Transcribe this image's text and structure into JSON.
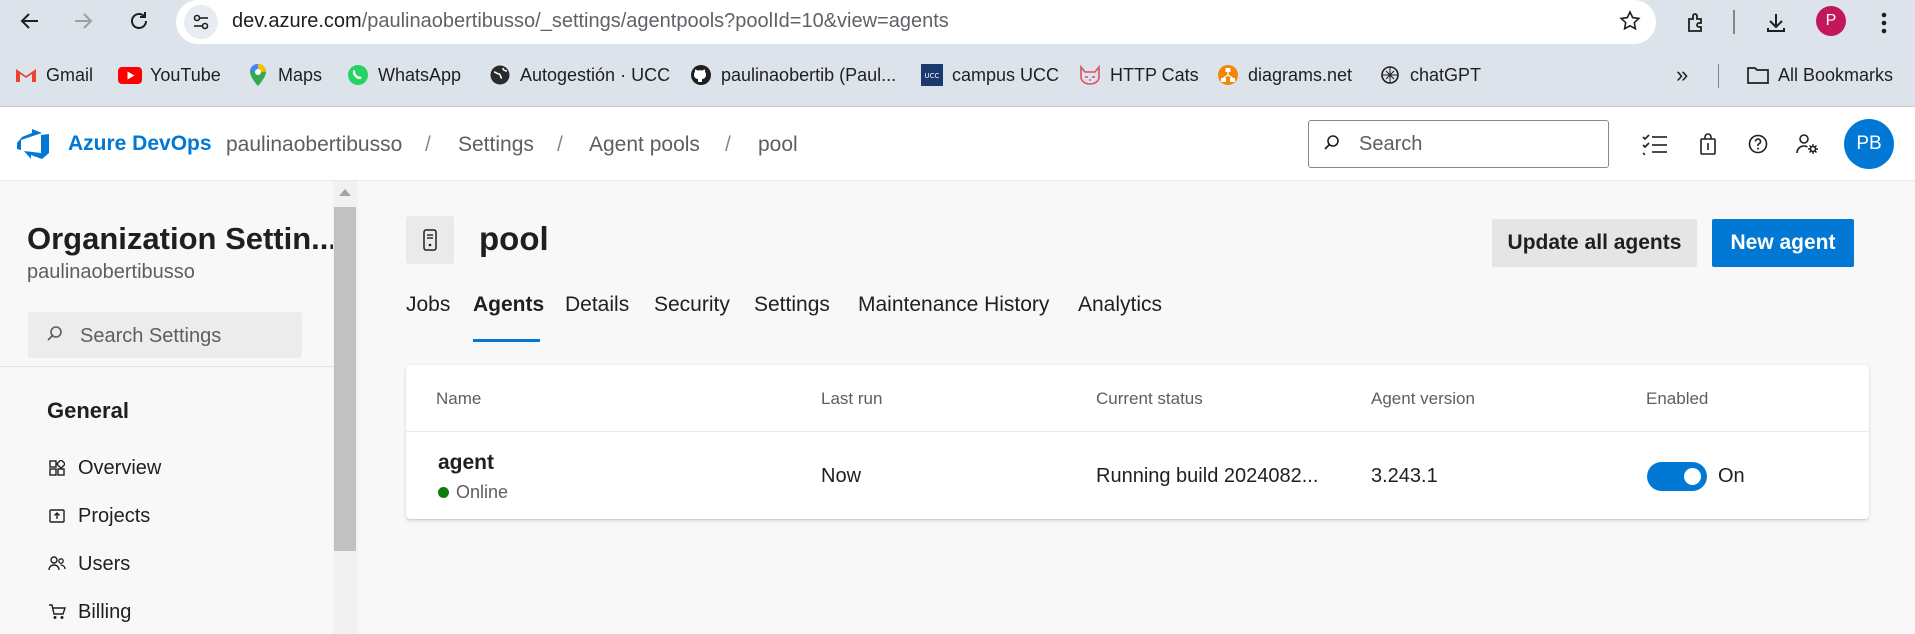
{
  "browser": {
    "url_host": "dev.azure.com",
    "url_path": "/paulinaobertibusso/_settings/agentpools?poolId=10&view=agents",
    "profile_initial": "P",
    "bookmarks": [
      {
        "label": "Gmail",
        "icon": "gmail-icon",
        "color": "#ea4335"
      },
      {
        "label": "YouTube",
        "icon": "youtube-icon",
        "color": "#ff0000"
      },
      {
        "label": "Maps",
        "icon": "maps-icon",
        "color": "#34a853"
      },
      {
        "label": "WhatsApp",
        "icon": "whatsapp-icon",
        "color": "#25d366"
      },
      {
        "label": "Autogestión · UCC",
        "icon": "globe-icon",
        "color": "#1f1f1f"
      },
      {
        "label": "paulinaobertib (Paul...",
        "icon": "github-icon",
        "color": "#1f1f1f"
      },
      {
        "label": "campus UCC",
        "icon": "ucc-icon",
        "color": "#1a3a6e"
      },
      {
        "label": "HTTP Cats",
        "icon": "cat-icon",
        "color": "#d8535f"
      },
      {
        "label": "diagrams.net",
        "icon": "diagrams-icon",
        "color": "#f08705"
      },
      {
        "label": "chatGPT",
        "icon": "openai-icon",
        "color": "#1f1f1f"
      }
    ],
    "more_label": "»",
    "all_bookmarks_label": "All Bookmarks"
  },
  "header": {
    "brand": "Azure DevOps",
    "breadcrumbs": [
      "paulinaobertibusso",
      "Settings",
      "Agent pools",
      "pool"
    ],
    "search_placeholder": "Search",
    "avatar_initials": "PB",
    "accent": "#0078d4"
  },
  "sidebar": {
    "title": "Organization Settin...",
    "subtitle": "paulinaobertibusso",
    "search_placeholder": "Search Settings",
    "group_title": "General",
    "items": [
      {
        "label": "Overview",
        "icon": "overview-icon"
      },
      {
        "label": "Projects",
        "icon": "projects-icon"
      },
      {
        "label": "Users",
        "icon": "users-icon"
      },
      {
        "label": "Billing",
        "icon": "billing-icon"
      }
    ]
  },
  "main": {
    "pool_title": "pool",
    "update_button": "Update all agents",
    "new_agent_button": "New agent",
    "tabs": [
      "Jobs",
      "Agents",
      "Details",
      "Security",
      "Settings",
      "Maintenance History",
      "Analytics"
    ],
    "active_tab": "Agents",
    "table": {
      "columns": [
        "Name",
        "Last run",
        "Current status",
        "Agent version",
        "Enabled"
      ],
      "rows": [
        {
          "name": "agent",
          "state": "Online",
          "state_color": "#107c10",
          "last_run": "Now",
          "status": "Running build 2024082...",
          "version": "3.243.1",
          "enabled": true,
          "enabled_label": "On"
        }
      ]
    }
  }
}
